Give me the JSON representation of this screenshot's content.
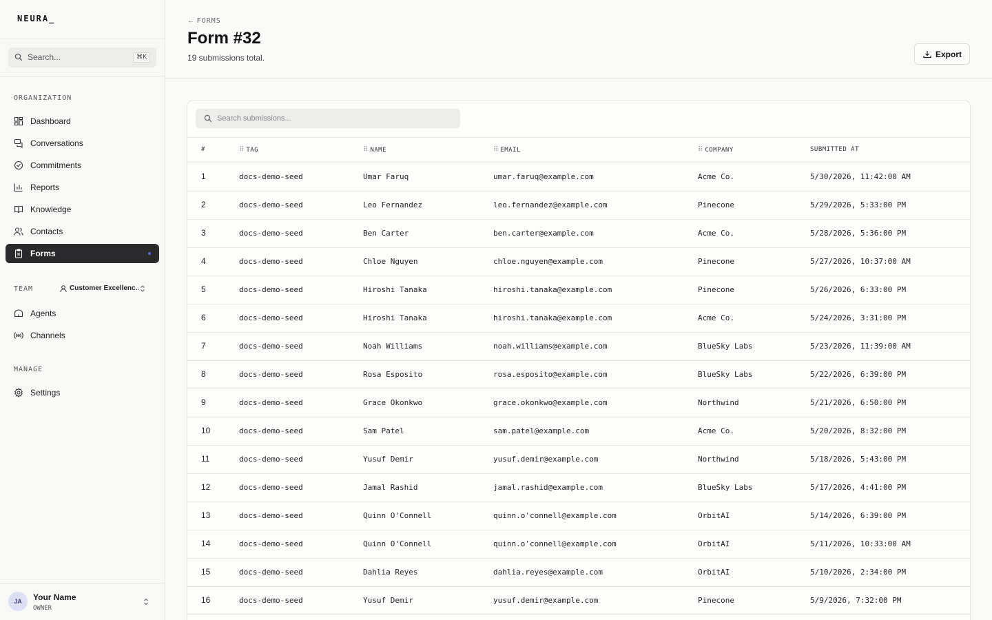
{
  "brand": {
    "logo": "NEURA_"
  },
  "sidebar": {
    "search": {
      "placeholder": "Search...",
      "shortcut": "⌘K"
    },
    "organization_label": "ORGANIZATION",
    "org_items": [
      {
        "label": "Dashboard",
        "icon": "dashboard-icon"
      },
      {
        "label": "Conversations",
        "icon": "chat-icon"
      },
      {
        "label": "Commitments",
        "icon": "check-circle-icon"
      },
      {
        "label": "Reports",
        "icon": "bar-chart-icon"
      },
      {
        "label": "Knowledge",
        "icon": "book-icon"
      },
      {
        "label": "Contacts",
        "icon": "users-icon"
      },
      {
        "label": "Forms",
        "icon": "clipboard-icon",
        "active": true
      }
    ],
    "team_label": "TEAM",
    "team_selector": {
      "label": "Customer Excellenc...",
      "icon": "user-icon"
    },
    "team_items": [
      {
        "label": "Agents",
        "icon": "bot-icon"
      },
      {
        "label": "Channels",
        "icon": "radio-icon"
      }
    ],
    "manage_label": "MANAGE",
    "manage_items": [
      {
        "label": "Settings",
        "icon": "gear-icon"
      }
    ],
    "user": {
      "initials": "JA",
      "name": "Your Name",
      "role": "OWNER"
    },
    "accent_color": "#5b6cf0"
  },
  "header": {
    "back_label": "FORMS",
    "title": "Form #32",
    "subtitle": "19 submissions total.",
    "export_label": "Export"
  },
  "table": {
    "search_placeholder": "Search submissions...",
    "columns": [
      "#",
      "TAG",
      "NAME",
      "EMAIL",
      "COMPANY",
      "SUBMITTED AT"
    ],
    "rows": [
      [
        "1",
        "docs-demo-seed",
        "Umar Faruq",
        "umar.faruq@example.com",
        "Acme Co.",
        "5/30/2026, 11:42:00 AM"
      ],
      [
        "2",
        "docs-demo-seed",
        "Leo Fernandez",
        "leo.fernandez@example.com",
        "Pinecone",
        "5/29/2026, 5:33:00 PM"
      ],
      [
        "3",
        "docs-demo-seed",
        "Ben Carter",
        "ben.carter@example.com",
        "Acme Co.",
        "5/28/2026, 5:36:00 PM"
      ],
      [
        "4",
        "docs-demo-seed",
        "Chloe Nguyen",
        "chloe.nguyen@example.com",
        "Pinecone",
        "5/27/2026, 10:37:00 AM"
      ],
      [
        "5",
        "docs-demo-seed",
        "Hiroshi Tanaka",
        "hiroshi.tanaka@example.com",
        "Pinecone",
        "5/26/2026, 6:33:00 PM"
      ],
      [
        "6",
        "docs-demo-seed",
        "Hiroshi Tanaka",
        "hiroshi.tanaka@example.com",
        "Acme Co.",
        "5/24/2026, 3:31:00 PM"
      ],
      [
        "7",
        "docs-demo-seed",
        "Noah Williams",
        "noah.williams@example.com",
        "BlueSky Labs",
        "5/23/2026, 11:39:00 AM"
      ],
      [
        "8",
        "docs-demo-seed",
        "Rosa Esposito",
        "rosa.esposito@example.com",
        "BlueSky Labs",
        "5/22/2026, 6:39:00 PM"
      ],
      [
        "9",
        "docs-demo-seed",
        "Grace Okonkwo",
        "grace.okonkwo@example.com",
        "Northwind",
        "5/21/2026, 6:50:00 PM"
      ],
      [
        "10",
        "docs-demo-seed",
        "Sam Patel",
        "sam.patel@example.com",
        "Acme Co.",
        "5/20/2026, 8:32:00 PM"
      ],
      [
        "11",
        "docs-demo-seed",
        "Yusuf Demir",
        "yusuf.demir@example.com",
        "Northwind",
        "5/18/2026, 5:43:00 PM"
      ],
      [
        "12",
        "docs-demo-seed",
        "Jamal Rashid",
        "jamal.rashid@example.com",
        "BlueSky Labs",
        "5/17/2026, 4:41:00 PM"
      ],
      [
        "13",
        "docs-demo-seed",
        "Quinn O'Connell",
        "quinn.o'connell@example.com",
        "OrbitAI",
        "5/14/2026, 6:39:00 PM"
      ],
      [
        "14",
        "docs-demo-seed",
        "Quinn O'Connell",
        "quinn.o'connell@example.com",
        "OrbitAI",
        "5/11/2026, 10:33:00 AM"
      ],
      [
        "15",
        "docs-demo-seed",
        "Dahlia Reyes",
        "dahlia.reyes@example.com",
        "OrbitAI",
        "5/10/2026, 2:34:00 PM"
      ],
      [
        "16",
        "docs-demo-seed",
        "Yusuf Demir",
        "yusuf.demir@example.com",
        "Pinecone",
        "5/9/2026, 7:32:00 PM"
      ]
    ]
  }
}
